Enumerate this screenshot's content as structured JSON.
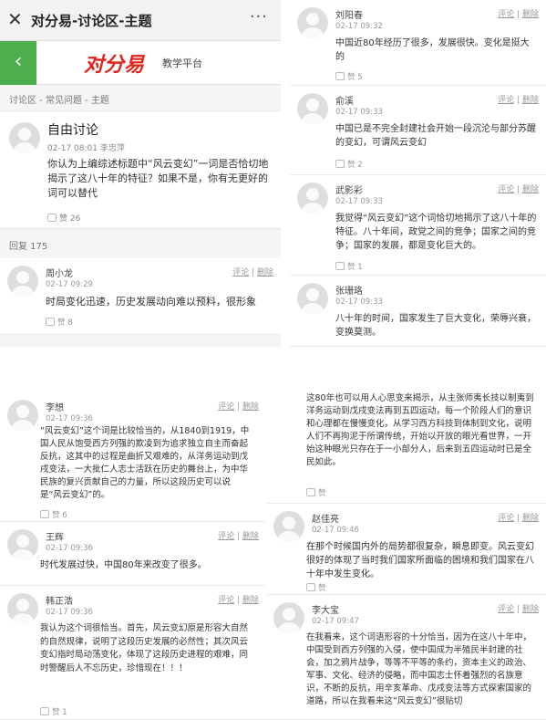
{
  "header": {
    "title": "对分易-讨论区-主题",
    "close_glyph": "✕",
    "more_glyph": "···"
  },
  "brand": {
    "back_glyph": "‹",
    "logo": "对分易",
    "subtitle": "教学平台"
  },
  "breadcrumb": "讨论区 - 常见问题 - 主题",
  "topic": {
    "title": "自由讨论",
    "time": "02-17 08:01",
    "author": "李忠萍",
    "body": "你认为上编综述标题中“风云变幻”一词是否恰切地揭示了这八十年的特征？如果不是，你有无更好的词可以替代",
    "likes": "赞 26"
  },
  "reply_count": "回复 175",
  "actions": {
    "comment": "评论",
    "sep": "|",
    "delete": "删除"
  },
  "posts_left_top": [
    {
      "name": "周小龙",
      "time": "02-17 09:29",
      "body": "时局变化迅速，历史发展动向难以预料，很形象",
      "likes": "赞 8"
    }
  ],
  "posts_right_top": [
    {
      "name": "刘阳春",
      "time": "02-17 09:32",
      "body": "中国近80年经历了很多，发展很快。变化是挺大的",
      "likes": "赞 5"
    },
    {
      "name": "俞溪",
      "time": "02-17 09:33",
      "body": "中国已是不完全封建社会开始一段沉沦与部分苏醒的变幻，可谓风云变幻",
      "likes": "赞 2"
    },
    {
      "name": "武影彩",
      "time": "02-17 09:33",
      "body": "我觉得“风云变幻”这个词恰切地揭示了这八十年的特征。八十年间，政党之间的竞争；国家之间的竞争；国家的发展，都是变化巨大的。",
      "likes": "赞 1"
    },
    {
      "name": "张珊珞",
      "time": "02-17 09:33",
      "body": "八十年的时间，国家发生了巨大变化，荣辱兴衰，变换莫测。",
      "likes": ""
    }
  ],
  "posts_left_bottom": [
    {
      "name": "李想",
      "time": "02-17 09:36",
      "body": "“风云变幻”这个词是比较恰当的，从1840到1919，中国人民从饱受西方列强的欺凌到为追求独立自主而奋起反抗，这其中的过程是曲折又艰难的，从洋务运动到戊戌变法，一大批仁人志士活跃在历史的舞台上，为中华民族的复兴贡献自己的力量，所以这段历史可以说是“风云变幻”的。",
      "likes": "赞 6"
    },
    {
      "name": "王辉",
      "time": "02-17 09:36",
      "body": "时代发展过快，中国80年来改变了很多。",
      "likes": ""
    },
    {
      "name": "韩正浩",
      "time": "02-17 09:36",
      "body": "我认为这个词很恰当。首先，风云变幻原是形容大自然的自然规律，说明了这段历史发展的必然性；其次风云变幻指时局动荡变化，体现了这段历史进程的艰难，同时警醒后人不忘历史，珍惜现在！！！",
      "likes": "赞 1"
    }
  ],
  "continued_text": "这80年也可以用人心思变来揭示，从主张师夷长技以制夷到洋务运动到戊戌变法再到五四运动，每一个阶段人们的意识和心理都在慢慢变化，从学习西方科技到体制到文化，说明人们不再拘泥于所谓传统，开始以开放的眼光看世界，一开始这种眼光只存在于一小部分人，后来到五四运动时已是全民如此。",
  "continued_likes": "赞",
  "posts_right_bottom": [
    {
      "name": "赵佳亮",
      "time": "02-17 09:46",
      "body": "在那个时候国内外的局势都很复杂，瞬息即变。风云变幻很好的体现了当时我们国家所面临的困境和我们国家在八十年中发生变化。",
      "likes": "赞"
    },
    {
      "name": "李大宝",
      "time": "02-17 09:47",
      "body": "在我看来，这个词语形容的十分恰当，因为在这八十年中，中国受到西方列强的入侵，使中国成为半殖民半封建的社会，加之鸦片战争，等等不平等的条约，资本主义的政治、军事、文化、经济的侵略，而中国志士怀着强烈的名族意识，不断的反抗，用辛亥革命、戊戌变法等方式探索国家的道路，所以在我看来这“风云变幻”很贴切",
      "likes": ""
    }
  ]
}
